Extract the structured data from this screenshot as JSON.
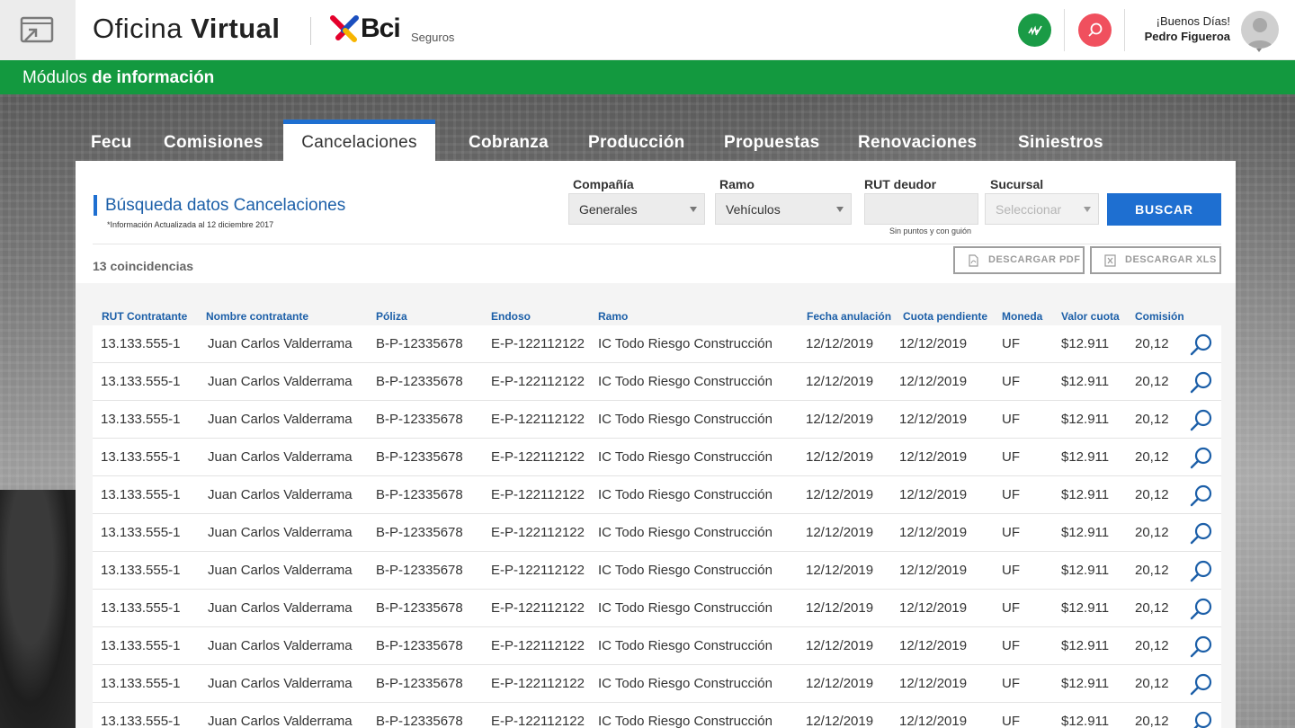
{
  "header": {
    "brand_light": "Oficina",
    "brand_bold": "Virtual",
    "bci": "Bci",
    "seguros": "Seguros",
    "greeting": "¡Buenos Días!",
    "user_name": "Pedro Figueroa"
  },
  "module_bar": {
    "prefix": "Módulos",
    "bold": "de información"
  },
  "tabs": [
    "Fecu",
    "Comisiones",
    "Cancelaciones",
    "Cobranza",
    "Producción",
    "Propuestas",
    "Renovaciones",
    "Siniestros"
  ],
  "search": {
    "title": "Búsqueda datos Cancelaciones",
    "note": "*Información Actualizada al 12 diciembre 2017",
    "compania_label": "Compañía",
    "compania_value": "Generales",
    "ramo_label": "Ramo",
    "ramo_value": "Vehículos",
    "rut_label": "RUT deudor",
    "rut_hint": "Sin puntos y con guión",
    "sucursal_label": "Sucursal",
    "sucursal_placeholder": "Seleccionar",
    "buscar_label": "BUSCAR"
  },
  "results": {
    "count": "13 coincidencias",
    "pdf_label": "DESCARGAR PDF",
    "xls_label": "DESCARGAR XLS"
  },
  "table": {
    "headers": [
      "RUT Contratante",
      "Nombre contratante",
      "Póliza",
      "Endoso",
      "Ramo",
      "Fecha anulación",
      "Cuota pendiente",
      "Moneda",
      "Valor cuota",
      "Comisión"
    ],
    "rows": [
      [
        "13.133.555-1",
        "Juan Carlos Valderrama",
        "B-P-12335678",
        "E-P-122112122",
        "IC Todo Riesgo Construcción",
        "12/12/2019",
        "12/12/2019",
        "UF",
        "$12.911",
        "20,12"
      ],
      [
        "13.133.555-1",
        "Juan Carlos Valderrama",
        "B-P-12335678",
        "E-P-122112122",
        "IC Todo Riesgo Construcción",
        "12/12/2019",
        "12/12/2019",
        "UF",
        "$12.911",
        "20,12"
      ],
      [
        "13.133.555-1",
        "Juan Carlos Valderrama",
        "B-P-12335678",
        "E-P-122112122",
        "IC Todo Riesgo Construcción",
        "12/12/2019",
        "12/12/2019",
        "UF",
        "$12.911",
        "20,12"
      ],
      [
        "13.133.555-1",
        "Juan Carlos Valderrama",
        "B-P-12335678",
        "E-P-122112122",
        "IC Todo Riesgo Construcción",
        "12/12/2019",
        "12/12/2019",
        "UF",
        "$12.911",
        "20,12"
      ],
      [
        "13.133.555-1",
        "Juan Carlos Valderrama",
        "B-P-12335678",
        "E-P-122112122",
        "IC Todo Riesgo Construcción",
        "12/12/2019",
        "12/12/2019",
        "UF",
        "$12.911",
        "20,12"
      ],
      [
        "13.133.555-1",
        "Juan Carlos Valderrama",
        "B-P-12335678",
        "E-P-122112122",
        "IC Todo Riesgo Construcción",
        "12/12/2019",
        "12/12/2019",
        "UF",
        "$12.911",
        "20,12"
      ],
      [
        "13.133.555-1",
        "Juan Carlos Valderrama",
        "B-P-12335678",
        "E-P-122112122",
        "IC Todo Riesgo Construcción",
        "12/12/2019",
        "12/12/2019",
        "UF",
        "$12.911",
        "20,12"
      ],
      [
        "13.133.555-1",
        "Juan Carlos Valderrama",
        "B-P-12335678",
        "E-P-122112122",
        "IC Todo Riesgo Construcción",
        "12/12/2019",
        "12/12/2019",
        "UF",
        "$12.911",
        "20,12"
      ],
      [
        "13.133.555-1",
        "Juan Carlos Valderrama",
        "B-P-12335678",
        "E-P-122112122",
        "IC Todo Riesgo Construcción",
        "12/12/2019",
        "12/12/2019",
        "UF",
        "$12.911",
        "20,12"
      ],
      [
        "13.133.555-1",
        "Juan Carlos Valderrama",
        "B-P-12335678",
        "E-P-122112122",
        "IC Todo Riesgo Construcción",
        "12/12/2019",
        "12/12/2019",
        "UF",
        "$12.911",
        "20,12"
      ],
      [
        "13.133.555-1",
        "Juan Carlos Valderrama",
        "B-P-12335678",
        "E-P-122112122",
        "IC Todo Riesgo Construcción",
        "12/12/2019",
        "12/12/2019",
        "UF",
        "$12.911",
        "20,12"
      ]
    ]
  },
  "icons": {
    "menu": "window-arrow-icon",
    "green_button": "signature-icon",
    "pink_button": "search-icon",
    "row_action": "search-icon",
    "pdf": "pdf-file-icon",
    "xls": "excel-file-icon"
  },
  "colors": {
    "green": "#13993f",
    "blue": "#1e6fd1",
    "title_blue": "#1c5fa8",
    "pink": "#f0505e"
  }
}
